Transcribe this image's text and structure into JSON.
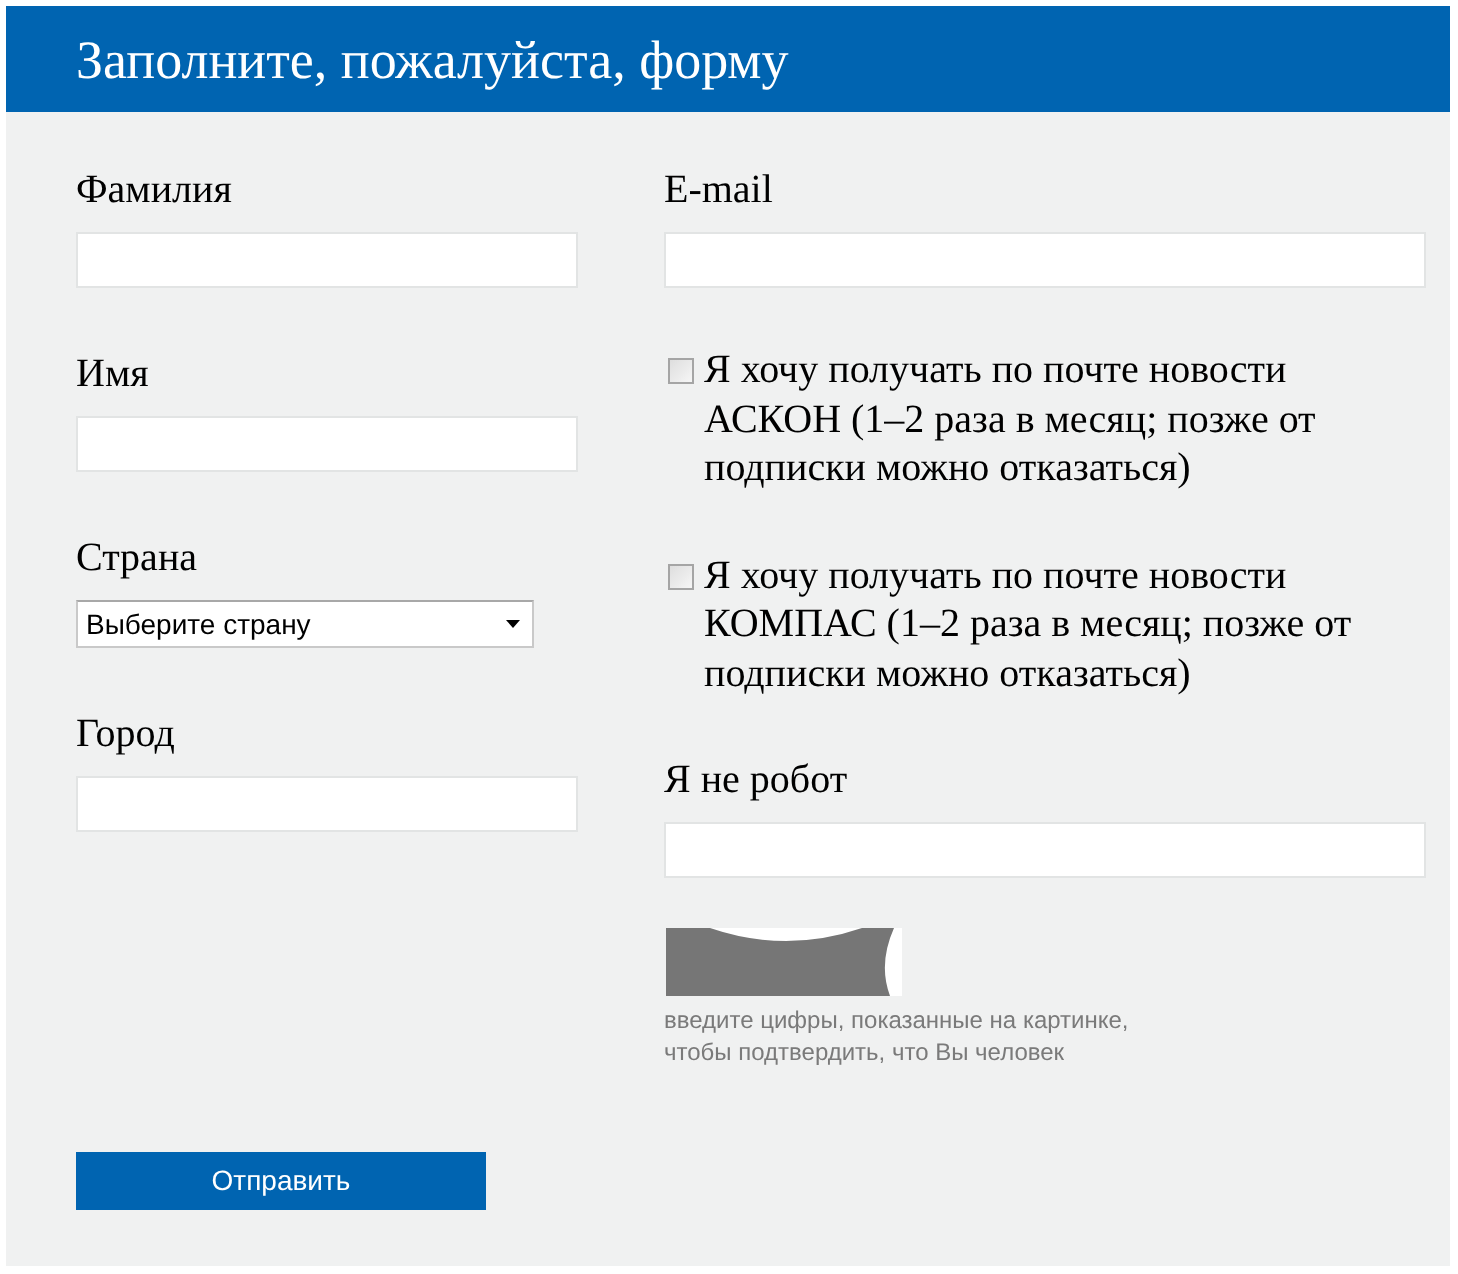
{
  "header": {
    "title": "Заполните, пожалуйста, форму"
  },
  "left_fields": [
    {
      "kind": "text",
      "label": "Фамилия"
    },
    {
      "kind": "text",
      "label": "Имя"
    },
    {
      "kind": "select",
      "label": "Страна",
      "value": "Выберите страну"
    },
    {
      "kind": "text",
      "label": "Город"
    }
  ],
  "right_fields": [
    {
      "kind": "text",
      "label": "E-mail"
    },
    {
      "kind": "checkbox",
      "label": "Я хочу получать по почте новости АСКОН (1–2 раза в месяц; позже от подписки можно отказаться)",
      "checked": false
    },
    {
      "kind": "checkbox",
      "label": "Я хочу получать по почте новости КОМПАС (1–2 раза в месяц; позже от подписки можно отказаться)",
      "checked": false
    },
    {
      "kind": "captcha",
      "label": "Я не робот",
      "hint": "введите цифры, показанные на картинке, чтобы подтвердить, что Вы человек"
    }
  ],
  "submit": {
    "label": "Отправить"
  }
}
